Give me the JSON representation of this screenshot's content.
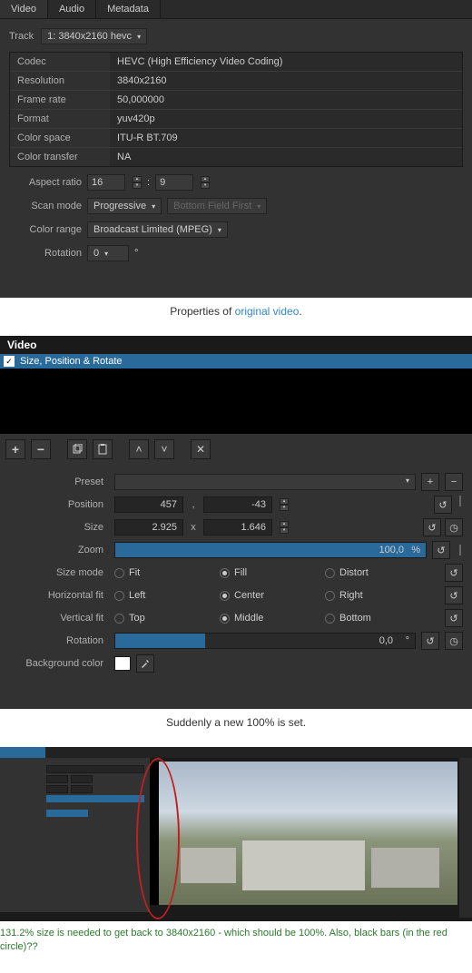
{
  "panel1": {
    "tabs": [
      "Video",
      "Audio",
      "Metadata"
    ],
    "track_label": "Track",
    "track_value": "1: 3840x2160 hevc",
    "info": [
      {
        "k": "Codec",
        "v": "HEVC (High Efficiency Video Coding)"
      },
      {
        "k": "Resolution",
        "v": "3840x2160"
      },
      {
        "k": "Frame rate",
        "v": "50,000000"
      },
      {
        "k": "Format",
        "v": "yuv420p"
      },
      {
        "k": "Color space",
        "v": "ITU-R BT.709"
      },
      {
        "k": "Color transfer",
        "v": "NA"
      }
    ],
    "aspect_label": "Aspect ratio",
    "aspect_w": "16",
    "aspect_h": "9",
    "aspect_sep": ":",
    "scan_label": "Scan mode",
    "scan_value": "Progressive",
    "field_value": "Bottom Field First",
    "color_range_label": "Color range",
    "color_range_value": "Broadcast Limited (MPEG)",
    "rotation_label": "Rotation",
    "rotation_value": "0",
    "rotation_unit": "°"
  },
  "caption1_pre": "Properties of ",
  "caption1_link": "original video",
  "caption1_post": ".",
  "panel2": {
    "header": "Video",
    "filter": "Size, Position & Rotate",
    "preset_label": "Preset",
    "position_label": "Position",
    "pos_x": "457",
    "pos_y": "-43",
    "pos_sep": ",",
    "size_label": "Size",
    "size_w": "2.925",
    "size_h": "1.646",
    "size_sep": "x",
    "zoom_label": "Zoom",
    "zoom_value": "100,0",
    "zoom_unit": "%",
    "sizemode_label": "Size mode",
    "sizemode_opts": [
      "Fit",
      "Fill",
      "Distort"
    ],
    "hfit_label": "Horizontal fit",
    "hfit_opts": [
      "Left",
      "Center",
      "Right"
    ],
    "vfit_label": "Vertical fit",
    "vfit_opts": [
      "Top",
      "Middle",
      "Bottom"
    ],
    "rotation_label": "Rotation",
    "rotation_value": "0,0",
    "rotation_unit": "°",
    "bg_label": "Background color"
  },
  "caption2": "Suddenly a new 100% is set.",
  "caption3": "131.2% size is needed to get back to 3840x2160 - which should be 100%. Also, black bars (in the red circle)??"
}
